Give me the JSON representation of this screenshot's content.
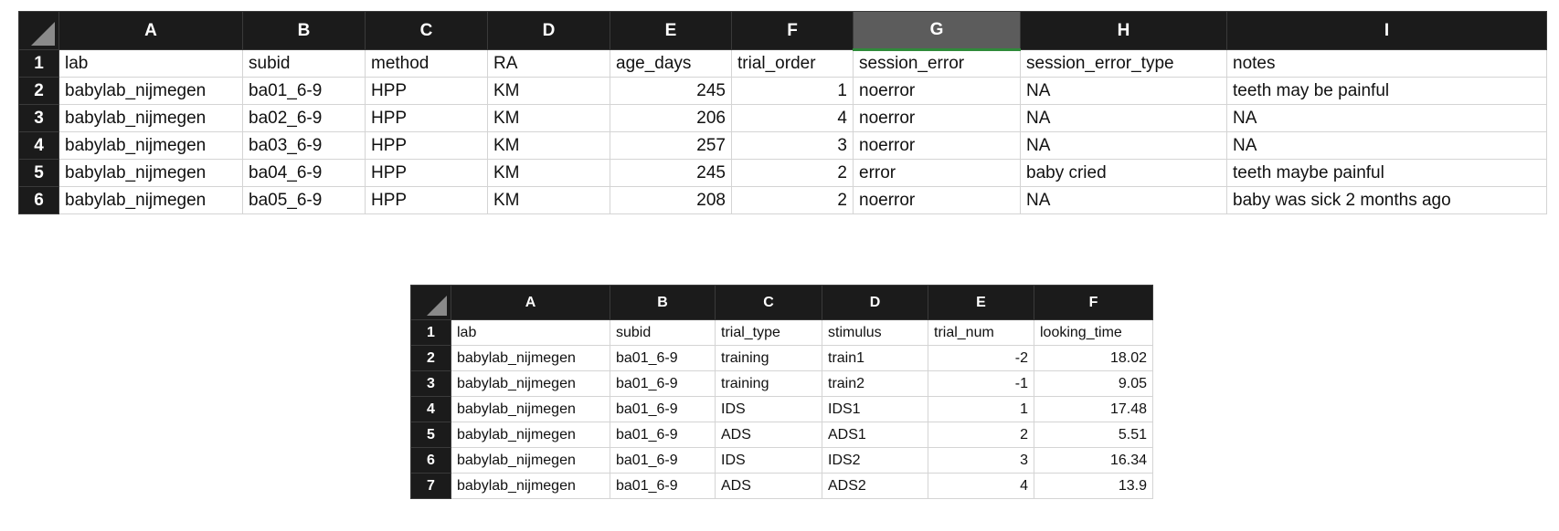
{
  "sheet1": {
    "columns": [
      "A",
      "B",
      "C",
      "D",
      "E",
      "F",
      "G",
      "H",
      "I"
    ],
    "rows": [
      {
        "num": "1",
        "cells": [
          "lab",
          "subid",
          "method",
          "RA",
          "age_days",
          "trial_order",
          "session_error",
          "session_error_type",
          "notes"
        ]
      },
      {
        "num": "2",
        "cells": [
          "babylab_nijmegen",
          "ba01_6-9",
          "HPP",
          "KM",
          "245",
          "1",
          "noerror",
          "NA",
          "teeth may be painful"
        ]
      },
      {
        "num": "3",
        "cells": [
          "babylab_nijmegen",
          "ba02_6-9",
          "HPP",
          "KM",
          "206",
          "4",
          "noerror",
          "NA",
          "NA"
        ]
      },
      {
        "num": "4",
        "cells": [
          "babylab_nijmegen",
          "ba03_6-9",
          "HPP",
          "KM",
          "257",
          "3",
          "noerror",
          "NA",
          "NA"
        ]
      },
      {
        "num": "5",
        "cells": [
          "babylab_nijmegen",
          "ba04_6-9",
          "HPP",
          "KM",
          "245",
          "2",
          "error",
          "baby cried",
          "teeth maybe painful"
        ]
      },
      {
        "num": "6",
        "cells": [
          "babylab_nijmegen",
          "ba05_6-9",
          "HPP",
          "KM",
          "208",
          "2",
          "noerror",
          "NA",
          "baby was sick 2 months ago"
        ]
      }
    ]
  },
  "sheet2": {
    "columns": [
      "A",
      "B",
      "C",
      "D",
      "E",
      "F"
    ],
    "rows": [
      {
        "num": "1",
        "cells": [
          "lab",
          "subid",
          "trial_type",
          "stimulus",
          "trial_num",
          "looking_time"
        ]
      },
      {
        "num": "2",
        "cells": [
          "babylab_nijmegen",
          "ba01_6-9",
          "training",
          "train1",
          "-2",
          "18.02"
        ]
      },
      {
        "num": "3",
        "cells": [
          "babylab_nijmegen",
          "ba01_6-9",
          "training",
          "train2",
          "-1",
          "9.05"
        ]
      },
      {
        "num": "4",
        "cells": [
          "babylab_nijmegen",
          "ba01_6-9",
          "IDS",
          "IDS1",
          "1",
          "17.48"
        ]
      },
      {
        "num": "5",
        "cells": [
          "babylab_nijmegen",
          "ba01_6-9",
          "ADS",
          "ADS1",
          "2",
          "5.51"
        ]
      },
      {
        "num": "6",
        "cells": [
          "babylab_nijmegen",
          "ba01_6-9",
          "IDS",
          "IDS2",
          "3",
          "16.34"
        ]
      },
      {
        "num": "7",
        "cells": [
          "babylab_nijmegen",
          "ba01_6-9",
          "ADS",
          "ADS2",
          "4",
          "13.9"
        ]
      }
    ]
  },
  "colors": {
    "header_bg": "#1b1b1b",
    "selected_header_bg": "#5c5c5c",
    "selected_indicator": "#2f8a3a"
  }
}
